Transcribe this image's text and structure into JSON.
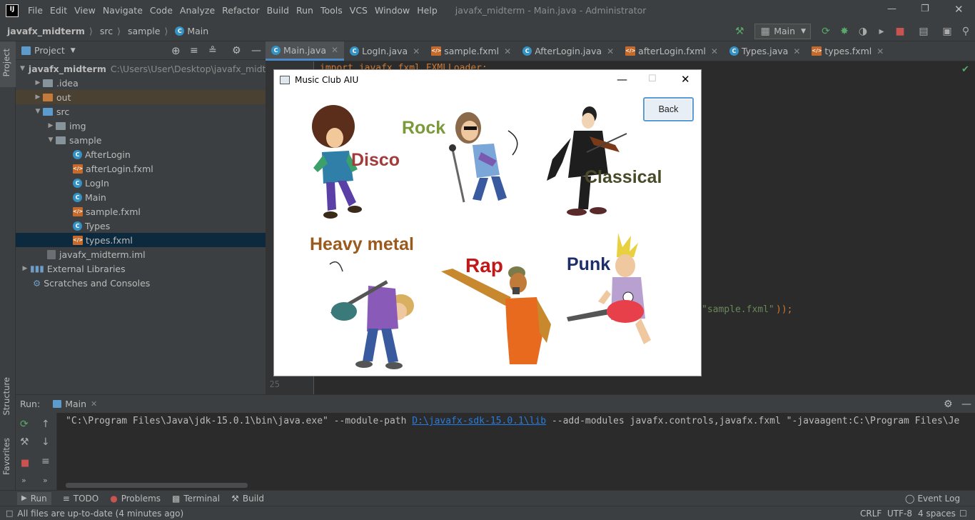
{
  "menubar": {
    "logo": "IJ",
    "items": [
      "File",
      "Edit",
      "View",
      "Navigate",
      "Code",
      "Analyze",
      "Refactor",
      "Build",
      "Run",
      "Tools",
      "VCS",
      "Window",
      "Help"
    ],
    "window_title": "javafx_midterm - Main.java - Administrator"
  },
  "navbar": {
    "crumbs": [
      "javafx_midterm",
      "src",
      "sample",
      "Main"
    ],
    "run_config": "Main"
  },
  "project": {
    "header": "Project",
    "tree": [
      {
        "label": "javafx_midterm",
        "path": "C:\\Users\\User\\Desktop\\javafx_midterm"
      },
      {
        "label": ".idea"
      },
      {
        "label": "out"
      },
      {
        "label": "src"
      },
      {
        "label": "img"
      },
      {
        "label": "sample"
      },
      {
        "label": "AfterLogin"
      },
      {
        "label": "afterLogin.fxml"
      },
      {
        "label": "LogIn"
      },
      {
        "label": "Main"
      },
      {
        "label": "sample.fxml"
      },
      {
        "label": "Types"
      },
      {
        "label": "types.fxml"
      },
      {
        "label": "javafx_midterm.iml"
      },
      {
        "label": "External Libraries"
      },
      {
        "label": "Scratches and Consoles"
      }
    ]
  },
  "side_tabs": {
    "project": "Project",
    "structure": "Structure",
    "favorites": "Favorites"
  },
  "editor": {
    "tabs": [
      "Main.java",
      "LogIn.java",
      "sample.fxml",
      "AfterLogin.java",
      "afterLogin.fxml",
      "Types.java",
      "types.fxml"
    ],
    "code_top": "import javafx.fxml.FXMLLoader;",
    "code_string": "\"sample.fxml\"",
    "code_tail": "));",
    "last_line": "25"
  },
  "run": {
    "label": "Run:",
    "tab": "Main",
    "console_prefix": "\"C:\\Program Files\\Java\\jdk-15.0.1\\bin\\java.exe\" --module-path ",
    "console_link": "D:\\javafx-sdk-15.0.1\\lib",
    "console_suffix": " --add-modules javafx.controls,javafx.fxml \"-javaagent:C:\\Program Files\\Je"
  },
  "bottom_tabs": {
    "run": "Run",
    "todo": "TODO",
    "problems": "Problems",
    "terminal": "Terminal",
    "build": "Build",
    "event_log": "Event Log"
  },
  "status": {
    "message": "All files are up-to-date (4 minutes ago)",
    "line_sep": "CRLF",
    "encoding": "UTF-8",
    "indent": "4 spaces"
  },
  "dialog": {
    "title": "Music Club AIU",
    "back": "Back",
    "genres": {
      "disco": "Disco",
      "rock": "Rock",
      "classical": "Classical",
      "heavy_metal": "Heavy metal",
      "rap": "Rap",
      "punk": "Punk"
    }
  },
  "colors": {
    "disco": "#a33b3b",
    "rock": "#7a9a3a",
    "classical": "#4a4a2a",
    "heavy_metal": "#9a5a1e",
    "rap": "#c11818",
    "punk": "#1d2e6b"
  }
}
